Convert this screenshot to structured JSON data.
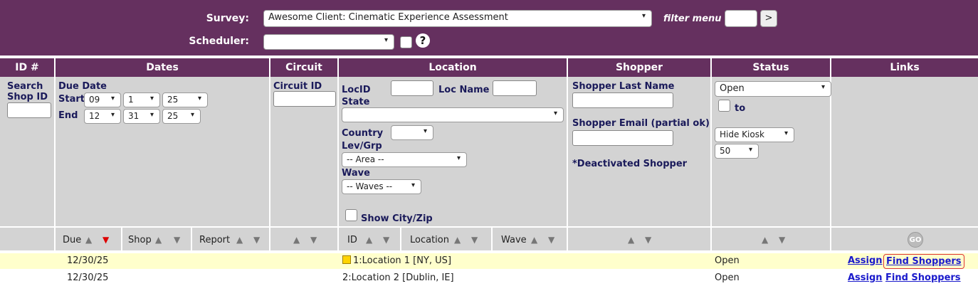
{
  "topbar": {
    "survey_label": "Survey:",
    "survey_value": "Awesome Client: Cinematic Experience Assessment",
    "scheduler_label": "Scheduler:",
    "scheduler_value": "",
    "help_glyph": "?",
    "filter_label": "filter menu",
    "filter_value": "",
    "go_label": ">"
  },
  "headers": [
    "ID #",
    "Dates",
    "Circuit",
    "Location",
    "Shopper",
    "Status",
    "Links"
  ],
  "filters": {
    "search_shop_id": "Search Shop ID",
    "due_date": "Due Date",
    "start": "Start",
    "start_month": "09",
    "start_day": "1",
    "start_year": "25",
    "end": "End",
    "end_month": "12",
    "end_day": "31",
    "end_year": "25",
    "circuit_id": "Circuit ID",
    "locid": "LocID",
    "loc_name": "Loc Name",
    "state": "State",
    "state_value": "",
    "country": "Country",
    "country_value": "",
    "lev_grp": "Lev/Grp",
    "area_value": "-- Area --",
    "wave": "Wave",
    "waves_value": "-- Waves --",
    "show_city_zip": "Show City/Zip",
    "shopper_last_name": "Shopper Last Name",
    "shopper_email": "Shopper Email (partial ok)",
    "deactivated_shopper": "*Deactivated Shopper",
    "status_value": "Open",
    "to": "to",
    "kiosk_value": "Hide Kiosk",
    "count_value": "50"
  },
  "sort": {
    "due": "Due",
    "shop": "Shop",
    "report": "Report",
    "id": "ID",
    "location": "Location",
    "wave": "Wave",
    "go": "GO"
  },
  "rows": [
    {
      "due": "12/30/25",
      "location": "1:Location 1 [NY, US]",
      "status": "Open",
      "assign": "Assign",
      "find": "Find Shoppers"
    },
    {
      "due": "12/30/25",
      "location": "2:Location 2 [Dublin, IE]",
      "status": "Open",
      "assign": "Assign",
      "find": "Find Shoppers"
    }
  ],
  "colors": {
    "header_bg": "#65305f",
    "filter_bg": "#d3d3d3",
    "highlight_row": "#ffffcc",
    "link": "#1a1acc",
    "sort_active": "#dd0000"
  }
}
